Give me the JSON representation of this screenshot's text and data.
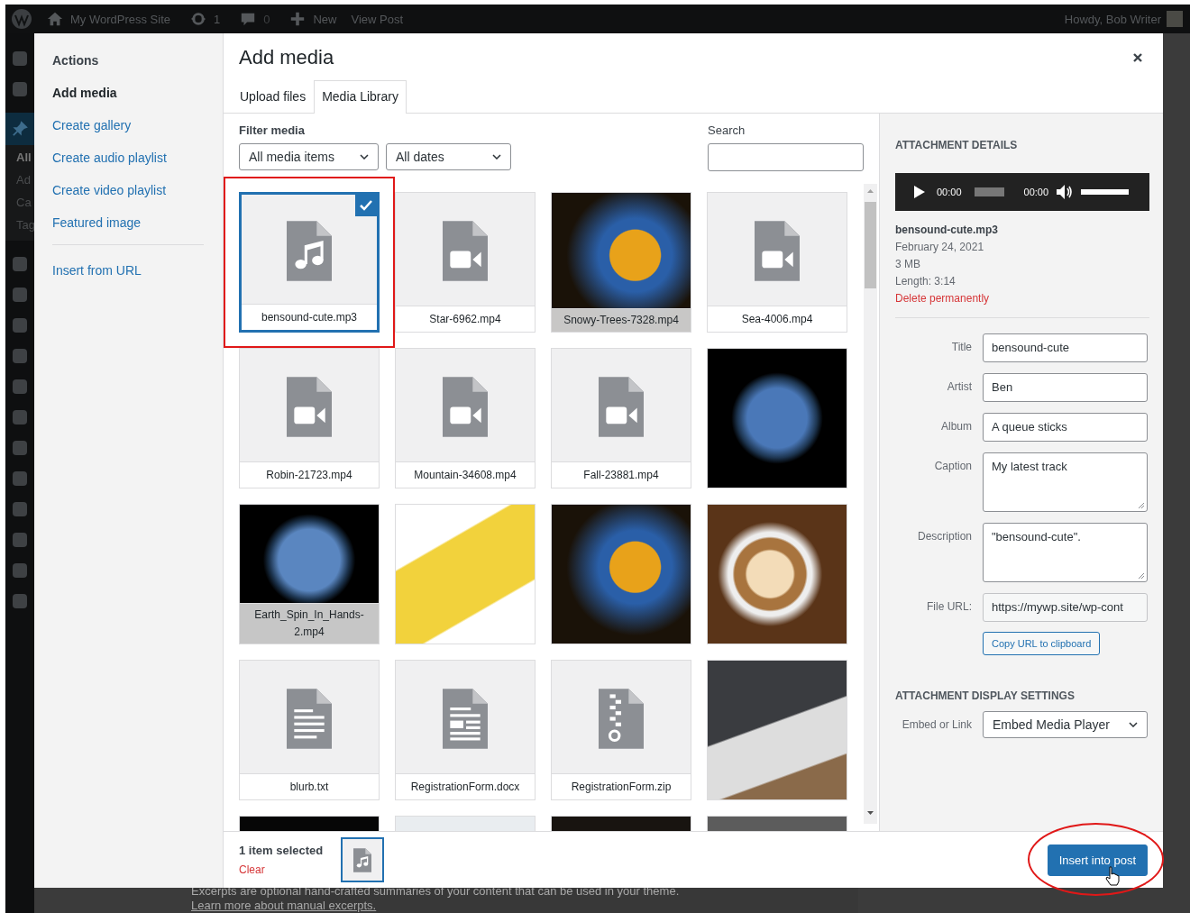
{
  "admin_bar": {
    "site_name": "My WordPress Site",
    "updates": "1",
    "comments": "0",
    "new_label": "New",
    "view_post": "View Post",
    "greeting": "Howdy, Bob Writer"
  },
  "admin_sidebar": {
    "sub_items": [
      "All",
      "Ad",
      "Ca",
      "Tag"
    ]
  },
  "background_page": {
    "excerpt_text": "Excerpts are optional hand-crafted summaries of your content that can be used in your theme.",
    "excerpt_link": "Learn more about manual excerpts."
  },
  "modal": {
    "menu": {
      "heading": "Actions",
      "items": [
        {
          "label": "Add media",
          "selected": true
        },
        {
          "label": "Create gallery",
          "selected": false
        },
        {
          "label": "Create audio playlist",
          "selected": false
        },
        {
          "label": "Create video playlist",
          "selected": false
        },
        {
          "label": "Featured image",
          "selected": false
        }
      ],
      "extra_items": [
        {
          "label": "Insert from URL",
          "selected": false
        }
      ]
    },
    "title": "Add media",
    "tabs": [
      {
        "label": "Upload files",
        "selected": false
      },
      {
        "label": "Media Library",
        "selected": true
      }
    ],
    "filters": {
      "label": "Filter media",
      "type_filter": "All media items",
      "date_filter": "All dates",
      "search_label": "Search"
    },
    "media": [
      {
        "kind": "audio",
        "caption": "bensound-cute.mp3",
        "selected": true
      },
      {
        "kind": "video",
        "caption": "Star-6962.mp4",
        "selected": false
      },
      {
        "kind": "photo",
        "caption": "Snowy-Trees-7328.mp4",
        "selected": false
      },
      {
        "kind": "video",
        "caption": "Sea-4006.mp4",
        "selected": false
      },
      {
        "kind": "video",
        "caption": "Robin-21723.mp4",
        "selected": false
      },
      {
        "kind": "video",
        "caption": "Mountain-34608.mp4",
        "selected": false
      },
      {
        "kind": "video",
        "caption": "Fall-23881.mp4",
        "selected": false
      },
      {
        "kind": "photo",
        "selected": false
      },
      {
        "kind": "photo",
        "caption": "Earth_Spin_In_Hands-2.mp4",
        "selected": false
      },
      {
        "kind": "photo",
        "selected": false
      },
      {
        "kind": "photo",
        "selected": false
      },
      {
        "kind": "photo",
        "selected": false
      },
      {
        "kind": "document",
        "caption": "blurb.txt",
        "selected": false
      },
      {
        "kind": "form",
        "caption": "RegistrationForm.docx",
        "selected": false
      },
      {
        "kind": "archive",
        "caption": "RegistrationForm.zip",
        "selected": false
      },
      {
        "kind": "photo",
        "selected": false
      },
      {
        "kind": "photo",
        "selected": false
      },
      {
        "kind": "photo",
        "selected": false
      },
      {
        "kind": "photo",
        "selected": false
      },
      {
        "kind": "photo",
        "selected": false
      }
    ],
    "details": {
      "heading": "ATTACHMENT DETAILS",
      "player": {
        "current_time": "00:00",
        "duration": "00:00",
        "volume": {
          "level": 1
        }
      },
      "file_name": "bensound-cute.mp3",
      "date": "February 24, 2021",
      "size": "3 MB",
      "length": "Length: 3:14",
      "delete_label": "Delete permanently",
      "fields": [
        {
          "kind": "text",
          "label": "Title",
          "value": "bensound-cute"
        },
        {
          "kind": "text",
          "label": "Artist",
          "value": "Ben"
        },
        {
          "kind": "text",
          "label": "Album",
          "value": "A queue sticks"
        },
        {
          "kind": "multiline",
          "label": "Caption",
          "value": "My latest track"
        },
        {
          "kind": "multiline",
          "label": "Description",
          "value": "\"bensound-cute\"."
        },
        {
          "kind": "readonly",
          "label": "File URL:",
          "value": "https://mywp.site/wp-cont"
        }
      ],
      "copy_button": "Copy URL to clipboard",
      "display_heading": "ATTACHMENT DISPLAY SETTINGS",
      "embed": {
        "label": "Embed or Link",
        "value": "Embed Media Player"
      }
    },
    "toolbar": {
      "selection_count": "1 item selected",
      "clear_label": "Clear",
      "insert_button": "Insert into post"
    }
  }
}
